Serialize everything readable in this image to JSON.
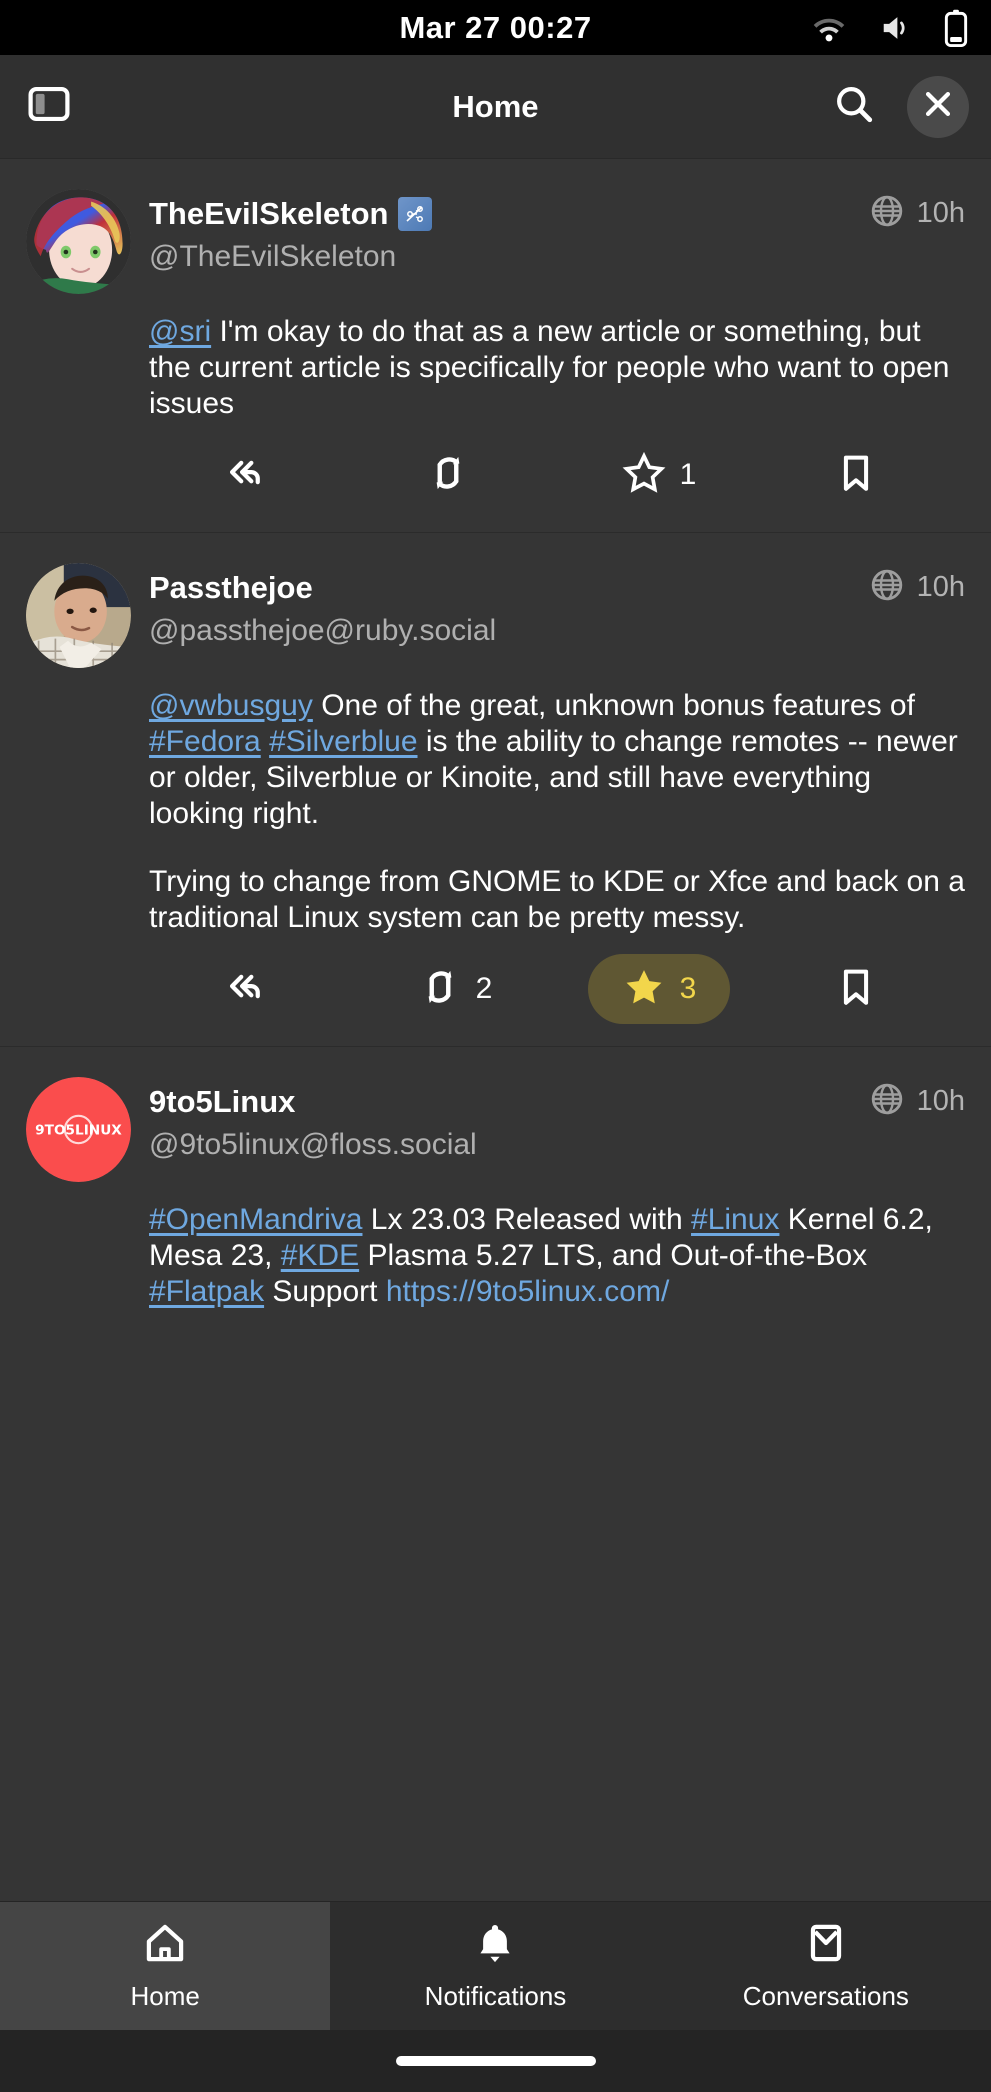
{
  "status_bar": {
    "clock": "Mar 27  00:27",
    "icons": [
      "wifi-icon",
      "volume-icon",
      "battery-icon"
    ]
  },
  "header": {
    "title": "Home",
    "sidebar_toggle": "sidebar-toggle-icon",
    "search": "search-icon",
    "close": "close-icon"
  },
  "colors": {
    "background": "#353535",
    "header": "#303030",
    "link": "#6fa8e0",
    "favorited": "#f2d64b",
    "text": "#ffffff",
    "muted": "#b0b0b0"
  },
  "posts": [
    {
      "display_name": "TheEvilSkeleton",
      "name_emoji": "custom-emoji-badge",
      "handle": "@TheEvilSkeleton",
      "visibility_icon": "globe-icon",
      "timestamp": "10h",
      "avatar": "anime-character-avatar",
      "body": [
        [
          {
            "t": "mention",
            "v": "@sri"
          },
          {
            "t": "text",
            "v": " I'm okay to do that as a new article or something, but the current article is specifically for people who want to open issues"
          }
        ]
      ],
      "actions": {
        "reply": {
          "icon": "reply-icon",
          "count": ""
        },
        "boost": {
          "icon": "boost-icon",
          "count": ""
        },
        "favorite": {
          "icon": "star-icon",
          "count": "1",
          "active": false
        },
        "bookmark": {
          "icon": "bookmark-icon",
          "count": ""
        }
      }
    },
    {
      "display_name": "Passthejoe",
      "name_emoji": "",
      "handle": "@passthejoe@ruby.social",
      "visibility_icon": "globe-icon",
      "timestamp": "10h",
      "avatar": "photo-avatar-man",
      "body": [
        [
          {
            "t": "mention",
            "v": "@vwbusguy"
          },
          {
            "t": "text",
            "v": " One of the great, unknown bonus features of "
          },
          {
            "t": "hashtag",
            "v": "#Fedora"
          },
          {
            "t": "text",
            "v": " "
          },
          {
            "t": "hashtag",
            "v": "#Silverblue"
          },
          {
            "t": "text",
            "v": " is the ability to change remotes -- newer or older, Silverblue or Kinoite, and still have everything looking right."
          }
        ],
        [
          {
            "t": "text",
            "v": "Trying to change from GNOME to KDE or Xfce and back on a traditional Linux system can be pretty messy."
          }
        ]
      ],
      "actions": {
        "reply": {
          "icon": "reply-icon",
          "count": ""
        },
        "boost": {
          "icon": "boost-icon",
          "count": "2"
        },
        "favorite": {
          "icon": "star-icon",
          "count": "3",
          "active": true
        },
        "bookmark": {
          "icon": "bookmark-icon",
          "count": ""
        }
      }
    },
    {
      "display_name": "9to5Linux",
      "name_emoji": "",
      "handle": "@9to5linux@floss.social",
      "visibility_icon": "globe-icon",
      "timestamp": "10h",
      "avatar": "9to5linux-logo-avatar",
      "avatar_text": "9TO5LINUX",
      "body": [
        [
          {
            "t": "hashtag",
            "v": "#OpenMandriva"
          },
          {
            "t": "text",
            "v": " Lx 23.03 Released with "
          },
          {
            "t": "hashtag",
            "v": "#Linux"
          },
          {
            "t": "text",
            "v": " Kernel 6.2, Mesa 23, "
          },
          {
            "t": "hashtag",
            "v": "#KDE"
          },
          {
            "t": "text",
            "v": " Plasma 5.27 LTS, and Out-of-the-Box "
          },
          {
            "t": "hashtag",
            "v": "#Flatpak"
          },
          {
            "t": "text",
            "v": " Support "
          },
          {
            "t": "url",
            "v": "https://9to5linux.com/"
          }
        ]
      ],
      "actions": null
    }
  ],
  "bottom_nav": {
    "items": [
      {
        "label": "Home",
        "icon": "home-icon",
        "selected": true
      },
      {
        "label": "Notifications",
        "icon": "bell-icon",
        "selected": false
      },
      {
        "label": "Conversations",
        "icon": "envelope-icon",
        "selected": false
      }
    ]
  }
}
